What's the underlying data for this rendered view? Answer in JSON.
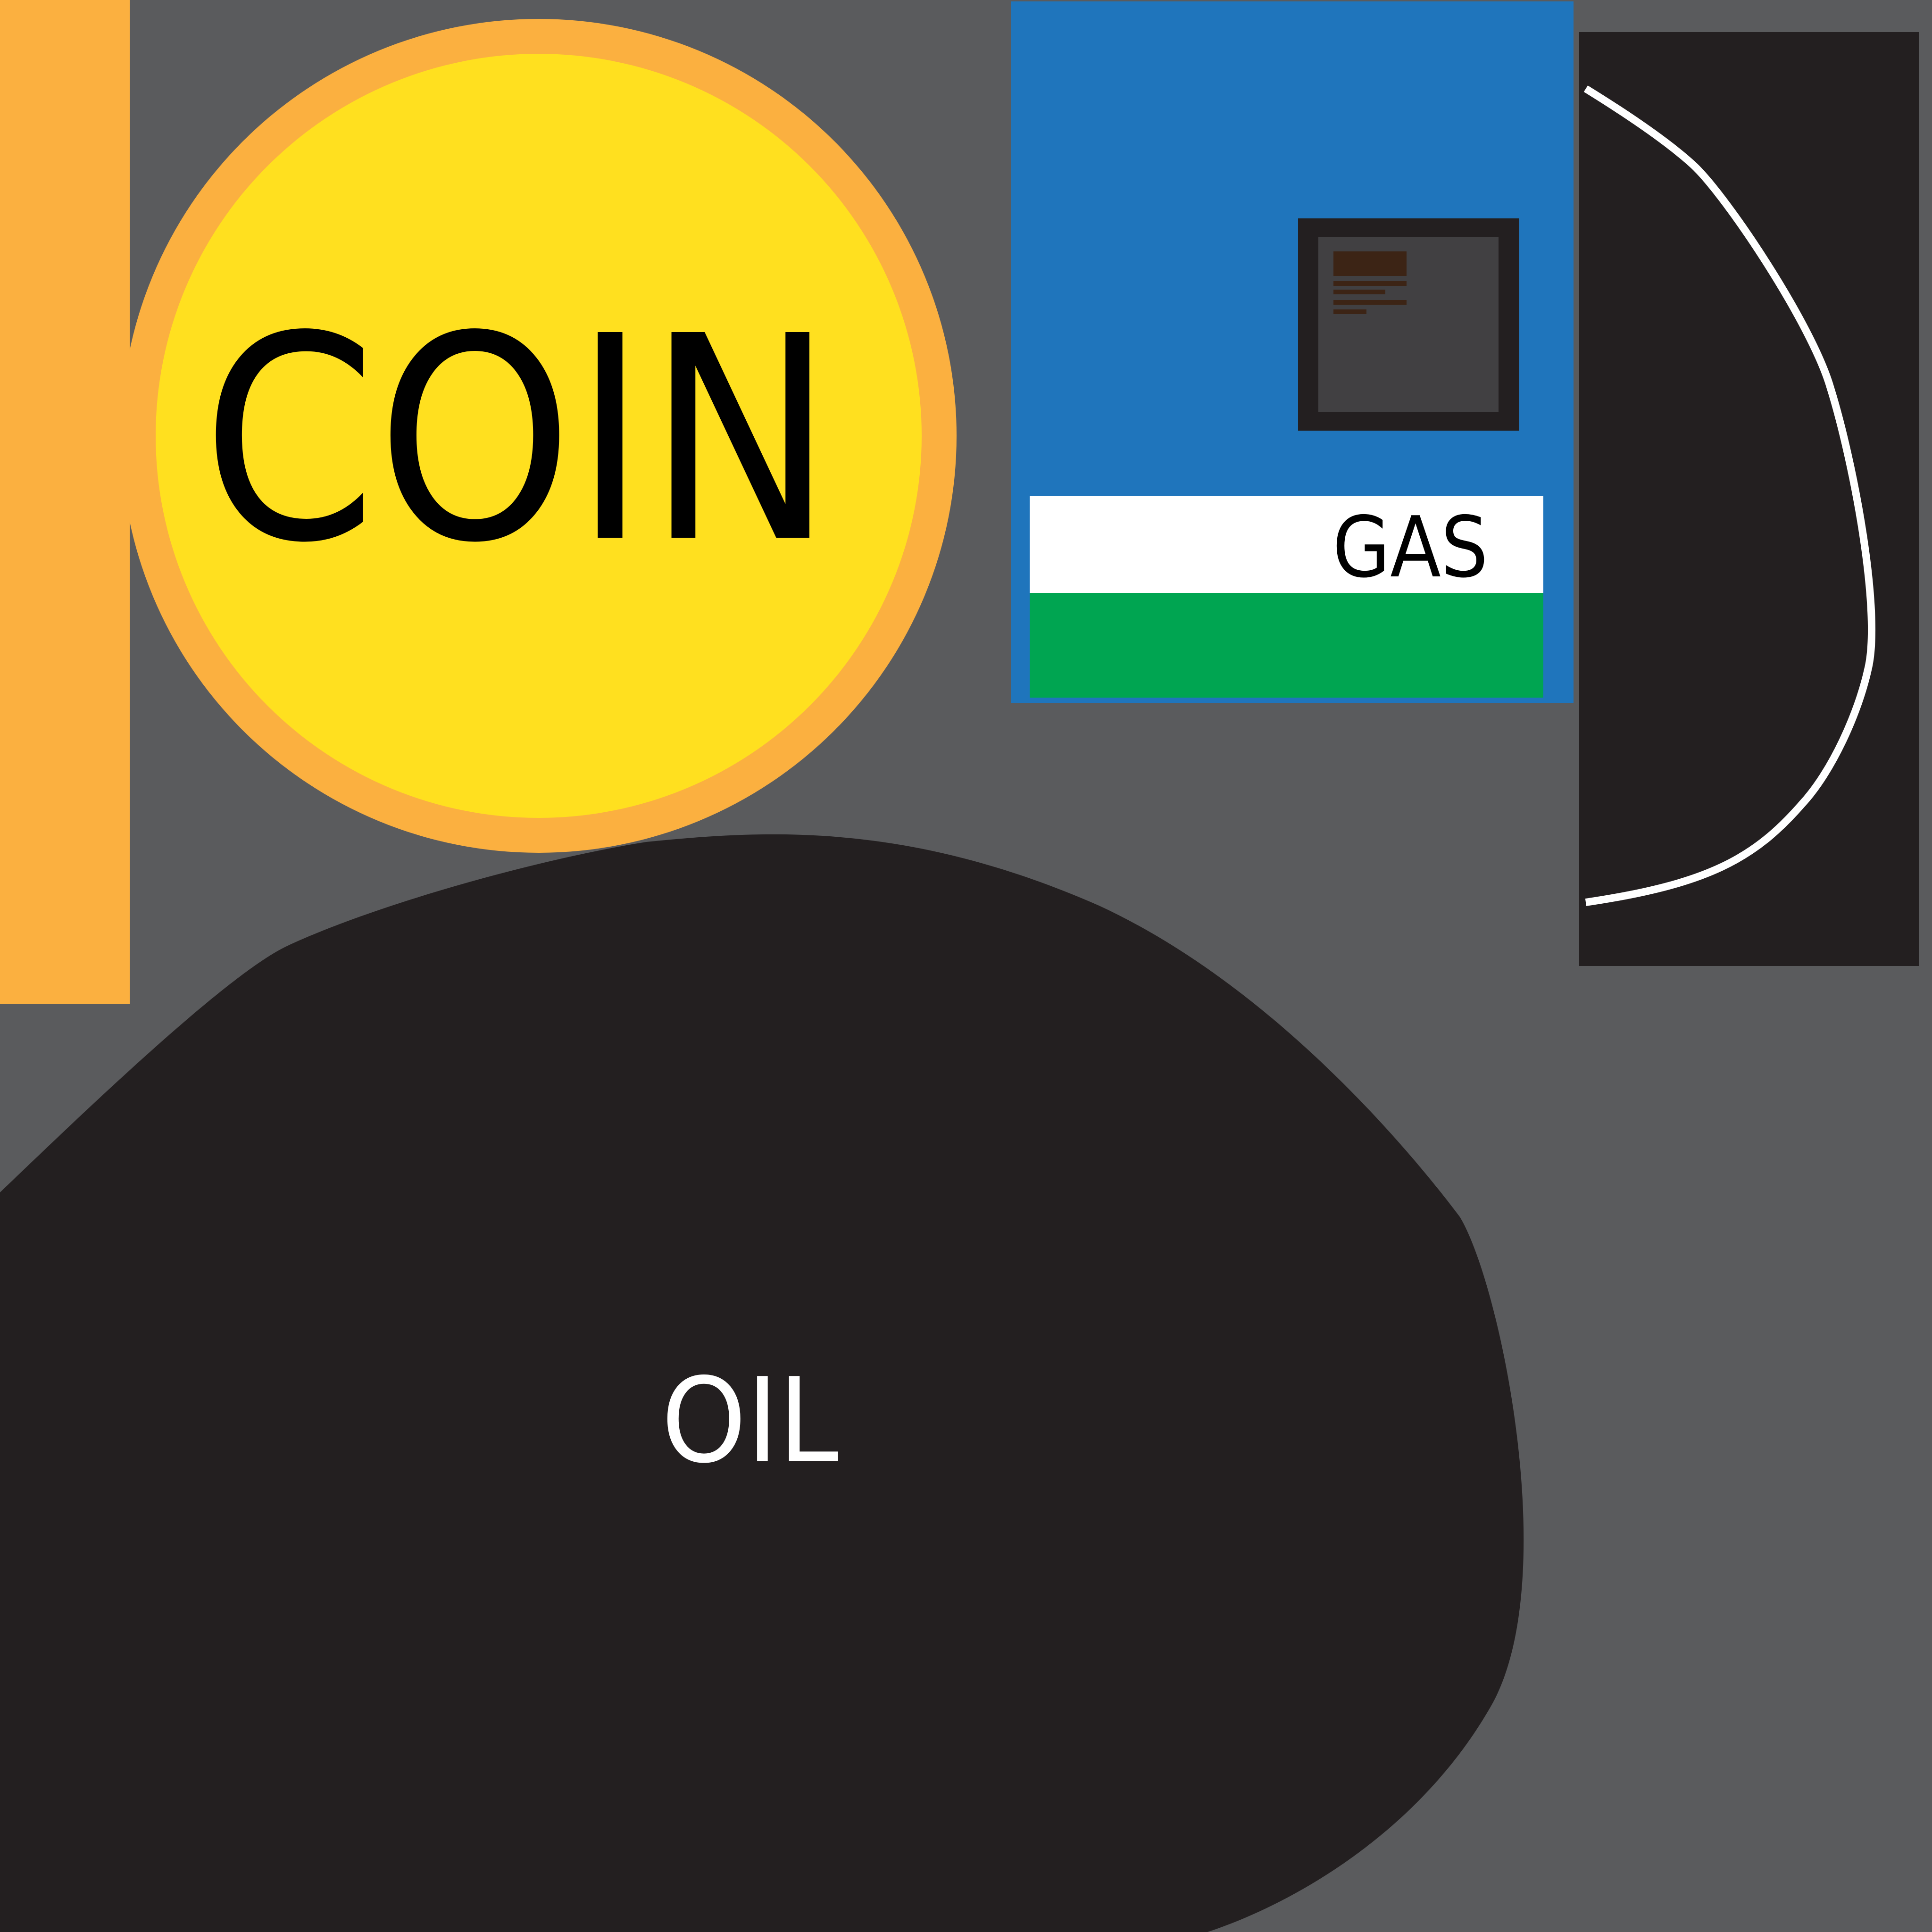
{
  "colors": {
    "background": "#5a5b5d",
    "coin_outer": "#fbb040",
    "coin_inner": "#ffe01f",
    "coin_text": "#000000",
    "pump_body": "#1f75bc",
    "pump_screen_frame": "#231f20",
    "pump_screen": "#414042",
    "pump_screen_lines": "#3c2415",
    "pump_label_band": "#ffffff",
    "pump_base_band": "#00a551",
    "pump_text": "#000000",
    "hose_panel": "#231f20",
    "hose_line": "#ffffff",
    "oil_blob": "#231f20",
    "oil_text": "#ffffff"
  },
  "coin": {
    "label": "COIN"
  },
  "pump": {
    "label": "GAS",
    "screen_icon": "display-screen-icon"
  },
  "hose": {
    "icon": "fuel-hose-icon"
  },
  "oil": {
    "label": "OIL",
    "icon": "oil-slick-icon"
  }
}
